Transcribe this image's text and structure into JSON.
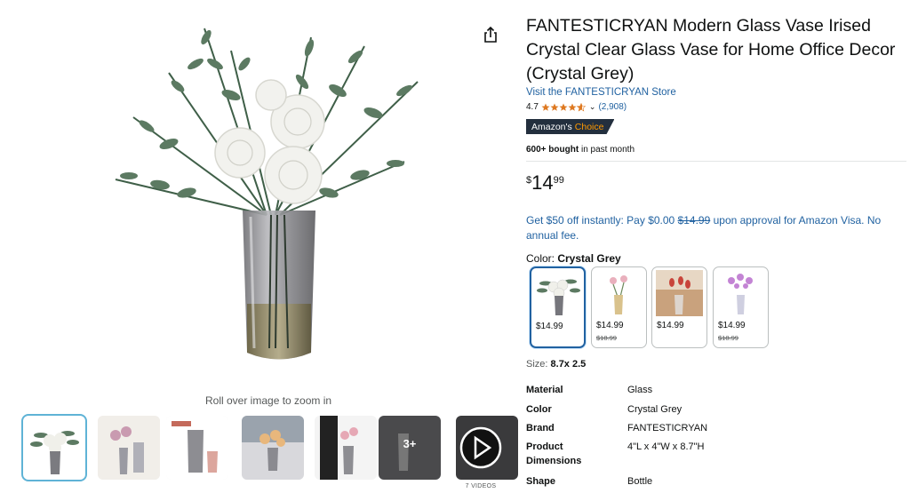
{
  "gallery": {
    "zoom_hint": "Roll over image to zoom in",
    "thumbs": [
      {
        "name": "thumb-1",
        "selected": true
      },
      {
        "name": "thumb-2",
        "selected": false
      },
      {
        "name": "thumb-3",
        "selected": false
      },
      {
        "name": "thumb-4",
        "selected": false
      },
      {
        "name": "thumb-5",
        "selected": false
      },
      {
        "name": "thumb-6",
        "badge": "3+"
      },
      {
        "name": "thumb-video"
      }
    ],
    "video_caption": "7 VIDEOS"
  },
  "product": {
    "title": "FANTESTICRYAN Modern Glass Vase Irised Crystal Clear Glass Vase for Home Office Decor (Crystal Grey)",
    "store_link": "Visit the FANTESTICRYAN Store",
    "rating": "4.7",
    "rating_value": 4.7,
    "reviews": "(2,908)",
    "badge_prefix": "Amazon's",
    "badge_word": "Choice",
    "bought_bold": "600+ bought",
    "bought_rest": " in past month",
    "price": {
      "symbol": "$",
      "whole": "14",
      "fraction": "99"
    },
    "promo_prefix": "Get $50 off instantly: Pay $0.00 ",
    "promo_strike": "$14.99",
    "promo_suffix": " upon approval for Amazon Visa. No annual fee.",
    "color_label": "Color: ",
    "color_value": "Crystal Grey",
    "swatches": [
      {
        "price": "$14.99",
        "old_price": ""
      },
      {
        "price": "$14.99",
        "old_price": "$18.99"
      },
      {
        "price": "$14.99",
        "old_price": ""
      },
      {
        "price": "$14.99",
        "old_price": "$18.99"
      }
    ],
    "size_label": "Size: ",
    "size_value": "8.7x 2.5",
    "specs": [
      {
        "key": "Material",
        "value": "Glass"
      },
      {
        "key": "Color",
        "value": "Crystal Grey"
      },
      {
        "key": "Brand",
        "value": "FANTESTICRYAN"
      },
      {
        "key": "Product Dimensions",
        "value": "4\"L x 4\"W x 8.7\"H"
      },
      {
        "key": "Shape",
        "value": "Bottle"
      }
    ]
  },
  "colors": {
    "link": "#2162a1",
    "badge_bg": "#232f3e",
    "badge_accent": "#ff9900",
    "star": "#de7921"
  }
}
